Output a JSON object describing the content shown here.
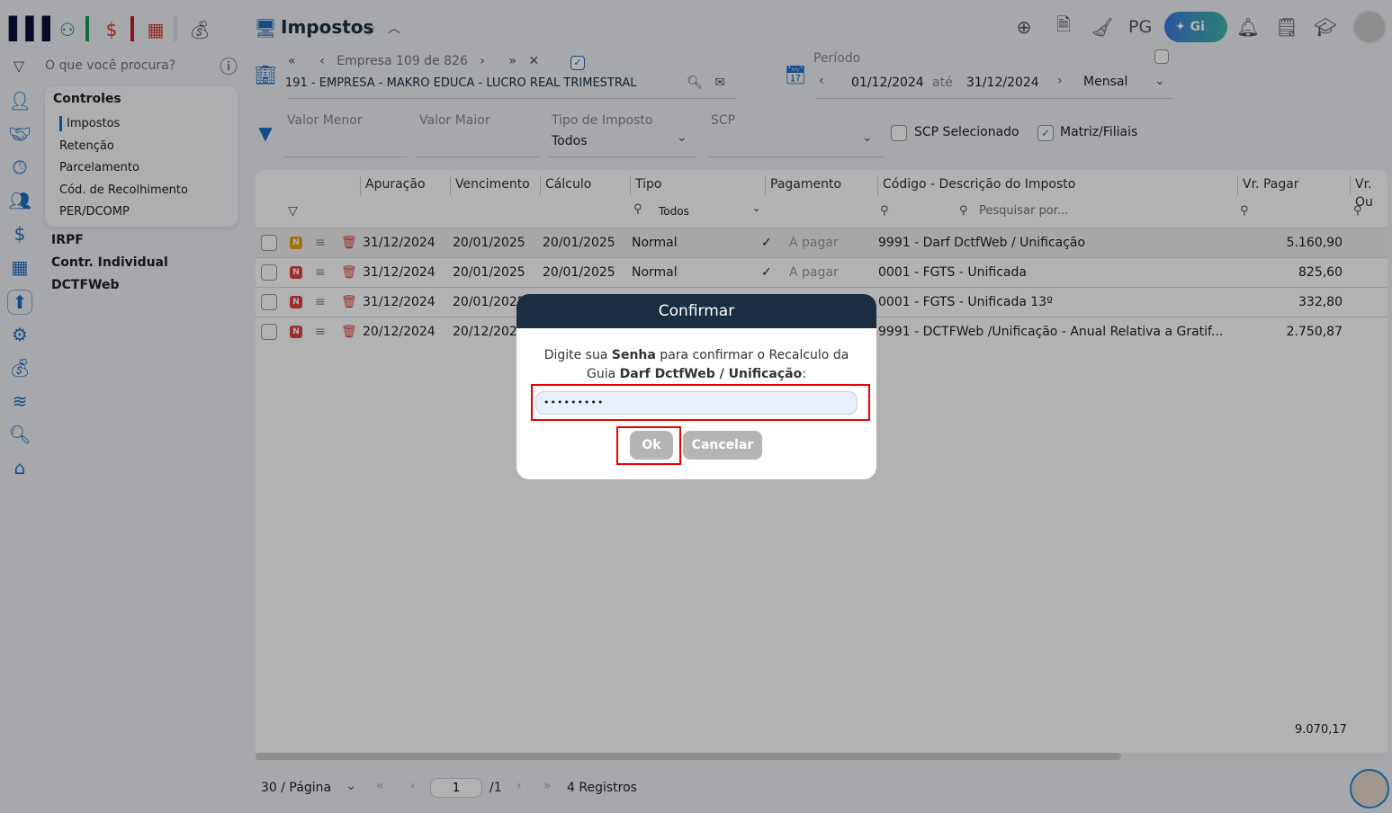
{
  "header": {
    "title": "Impostos",
    "info_icon": "info-icon",
    "pg_label": "PG",
    "gi_label": "Gi"
  },
  "search": {
    "placeholder": "O que você procura?"
  },
  "sidebar": {
    "section": "Controles",
    "items": [
      "Impostos",
      "Retenção",
      "Parcelamento",
      "Cód. de Recolhimento",
      "PER/DCOMP"
    ],
    "top_items": [
      "IRPF",
      "Contr. Individual",
      "DCTFWeb"
    ]
  },
  "company": {
    "nav": "Empresa 109 de 826",
    "name": "191 - EMPRESA - MAKRO EDUCA - LUCRO REAL TRIMESTRAL"
  },
  "period": {
    "label": "Período",
    "from": "01/12/2024",
    "sep": "até",
    "to": "31/12/2024",
    "mode": "Mensal"
  },
  "filters": {
    "valor_menor": "Valor Menor",
    "valor_maior": "Valor Maior",
    "tipo_label": "Tipo de Imposto",
    "tipo_value": "Todos",
    "scp": "SCP",
    "scp_sel": "SCP Selecionado",
    "matriz": "Matriz/Filiais"
  },
  "table": {
    "headers": [
      "Apuração",
      "Vencimento",
      "Cálculo",
      "Tipo",
      "Pagamento",
      "Código - Descrição do Imposto",
      "Vr. Pagar",
      "Vr. Ou"
    ],
    "tipo_filter": "Todos",
    "search_placeholder": "Pesquisar por...",
    "rows": [
      {
        "badge": "N",
        "badge_color": "#e8a317",
        "apuracao": "31/12/2024",
        "vencimento": "20/01/2025",
        "calculo": "20/01/2025",
        "tipo": "Normal",
        "pagamento": "A pagar",
        "descricao": "9991 - Darf DctfWeb / Unificação",
        "valor": "5.160,90"
      },
      {
        "badge": "N",
        "badge_color": "#e04646",
        "apuracao": "31/12/2024",
        "vencimento": "20/01/2025",
        "calculo": "20/01/2025",
        "tipo": "Normal",
        "pagamento": "A pagar",
        "descricao": "0001 - FGTS - Unificada",
        "valor": "825,60"
      },
      {
        "badge": "N",
        "badge_color": "#e04646",
        "apuracao": "31/12/2024",
        "vencimento": "20/01/2025",
        "calculo": "",
        "tipo": "",
        "pagamento": "",
        "descricao": "0001 - FGTS - Unificada 13º",
        "valor": "332,80"
      },
      {
        "badge": "N",
        "badge_color": "#e04646",
        "apuracao": "20/12/2024",
        "vencimento": "20/12/2024",
        "calculo": "",
        "tipo": "",
        "pagamento": "",
        "descricao": "9991 - DCTFWeb /Unificação - Anual Relativa a Gratif...",
        "valor": "2.750,87"
      }
    ],
    "total": "9.070,17"
  },
  "pagination": {
    "per_page": "30 / Página",
    "page": "1",
    "total_pages": "/1",
    "records": "4 Registros"
  },
  "modal": {
    "title": "Confirmar",
    "msg1": "Digite sua ",
    "msg_bold1": "Senha",
    "msg2": " para confirmar o Recalculo da Guia ",
    "msg_bold2": "Darf DctfWeb / Unificação",
    "msg3": ":",
    "password": "•••••••••",
    "ok": "Ok",
    "cancel": "Cancelar"
  }
}
